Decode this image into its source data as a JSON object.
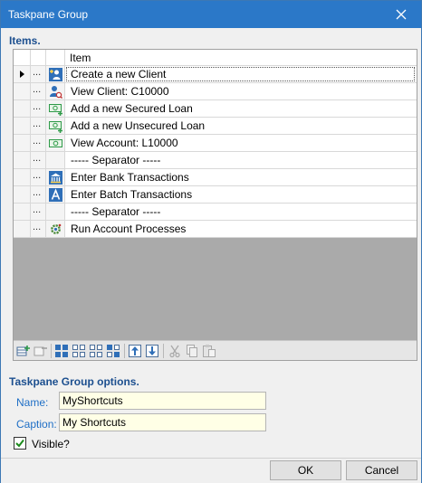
{
  "window": {
    "title": "Taskpane Group"
  },
  "items_section": {
    "label": "Items."
  },
  "grid": {
    "column_header": "Item",
    "rows": [
      {
        "label": "Create a new Client",
        "icon": "client-add-icon",
        "selected": true
      },
      {
        "label": "View Client: C10000",
        "icon": "client-view-icon"
      },
      {
        "label": "Add a new Secured Loan",
        "icon": "money-add-icon"
      },
      {
        "label": "Add a new Unsecured Loan",
        "icon": "money-add-icon"
      },
      {
        "label": "View Account: L10000",
        "icon": "money-view-icon"
      },
      {
        "label": "----- Separator -----",
        "icon": "none"
      },
      {
        "label": "Enter Bank Transactions",
        "icon": "bank-icon"
      },
      {
        "label": "Enter Batch Transactions",
        "icon": "batch-icon"
      },
      {
        "label": "----- Separator -----",
        "icon": "none"
      },
      {
        "label": "Run Account Processes",
        "icon": "gear-icon"
      }
    ],
    "row_dots": "..."
  },
  "options_section": {
    "label": "Taskpane Group options."
  },
  "fields": {
    "name_label": "Name:",
    "name_value": "MyShortcuts",
    "caption_label": "Caption:",
    "caption_value": "My Shortcuts",
    "visible_label": "Visible?",
    "visible_checked": true
  },
  "buttons": {
    "ok": "OK",
    "cancel": "Cancel"
  },
  "colors": {
    "titlebar": "#2b78c8",
    "section_label": "#1c4f8f",
    "field_label": "#1f6fc6",
    "input_bg": "#ffffe6"
  }
}
